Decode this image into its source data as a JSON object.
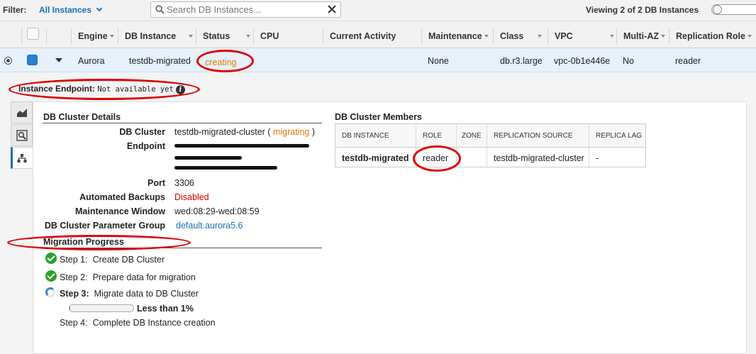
{
  "filter_bar": {
    "label": "Filter:",
    "selected": "All Instances",
    "search_placeholder": "Search DB Instances...",
    "viewing": "Viewing 2 of 2 DB Instances"
  },
  "table": {
    "columns": [
      "Engine",
      "DB Instance",
      "Status",
      "CPU",
      "Current Activity",
      "Maintenance",
      "Class",
      "VPC",
      "Multi-AZ",
      "Replication Role"
    ],
    "row": {
      "engine": "Aurora",
      "db_instance": "testdb-migrated",
      "status": "creating",
      "cpu": "",
      "current_activity": "",
      "maintenance": "None",
      "class": "db.r3.large",
      "vpc": "vpc-0b1e446e",
      "multi_az": "No",
      "replication_role": "reader"
    }
  },
  "details": {
    "endpoint_label": "Instance Endpoint:",
    "endpoint_value": "Not available yet",
    "cluster_section_title": "DB Cluster Details",
    "cluster": {
      "db_cluster_label": "DB Cluster",
      "db_cluster_value": "testdb-migrated-cluster",
      "db_cluster_status": "migrating",
      "endpoint_label": "Endpoint",
      "port_label": "Port",
      "port_value": "3306",
      "backups_label": "Automated Backups",
      "backups_value": "Disabled",
      "maint_window_label": "Maintenance Window",
      "maint_window_value": "wed:08:29-wed:08:59",
      "param_group_label": "DB Cluster Parameter Group",
      "param_group_value": "default.aurora5.6"
    },
    "members_section_title": "DB Cluster Members",
    "members_columns": [
      "DB INSTANCE",
      "ROLE",
      "ZONE",
      "REPLICATION SOURCE",
      "REPLICA LAG"
    ],
    "members_row": {
      "db_instance": "testdb-migrated",
      "role": "reader",
      "zone": "",
      "replication_source": "testdb-migrated-cluster",
      "replica_lag": "-"
    },
    "migration_section_title": "Migration Progress",
    "steps": [
      {
        "num": "Step 1:",
        "text": "Create DB Cluster",
        "state": "done"
      },
      {
        "num": "Step 2:",
        "text": "Prepare data for migration",
        "state": "done"
      },
      {
        "num": "Step 3:",
        "text": "Migrate data to DB Cluster",
        "state": "in-progress"
      },
      {
        "num": "Step 4:",
        "text": "Complete DB Instance creation",
        "state": "pending"
      }
    ],
    "progress_percent": 1,
    "progress_text": "Less than 1%"
  },
  "colors": {
    "accent": "#1a6fb3",
    "status_orange": "#e07b00",
    "disabled_red": "#d40000",
    "success_green": "#2aa22a",
    "annotation_red": "#e00000"
  },
  "icons": [
    "search-icon",
    "clear-icon",
    "chevron-down-icon",
    "info-icon",
    "chart-icon",
    "magnifier-icon",
    "cluster-tree-icon",
    "check-icon",
    "spinner-icon"
  ]
}
